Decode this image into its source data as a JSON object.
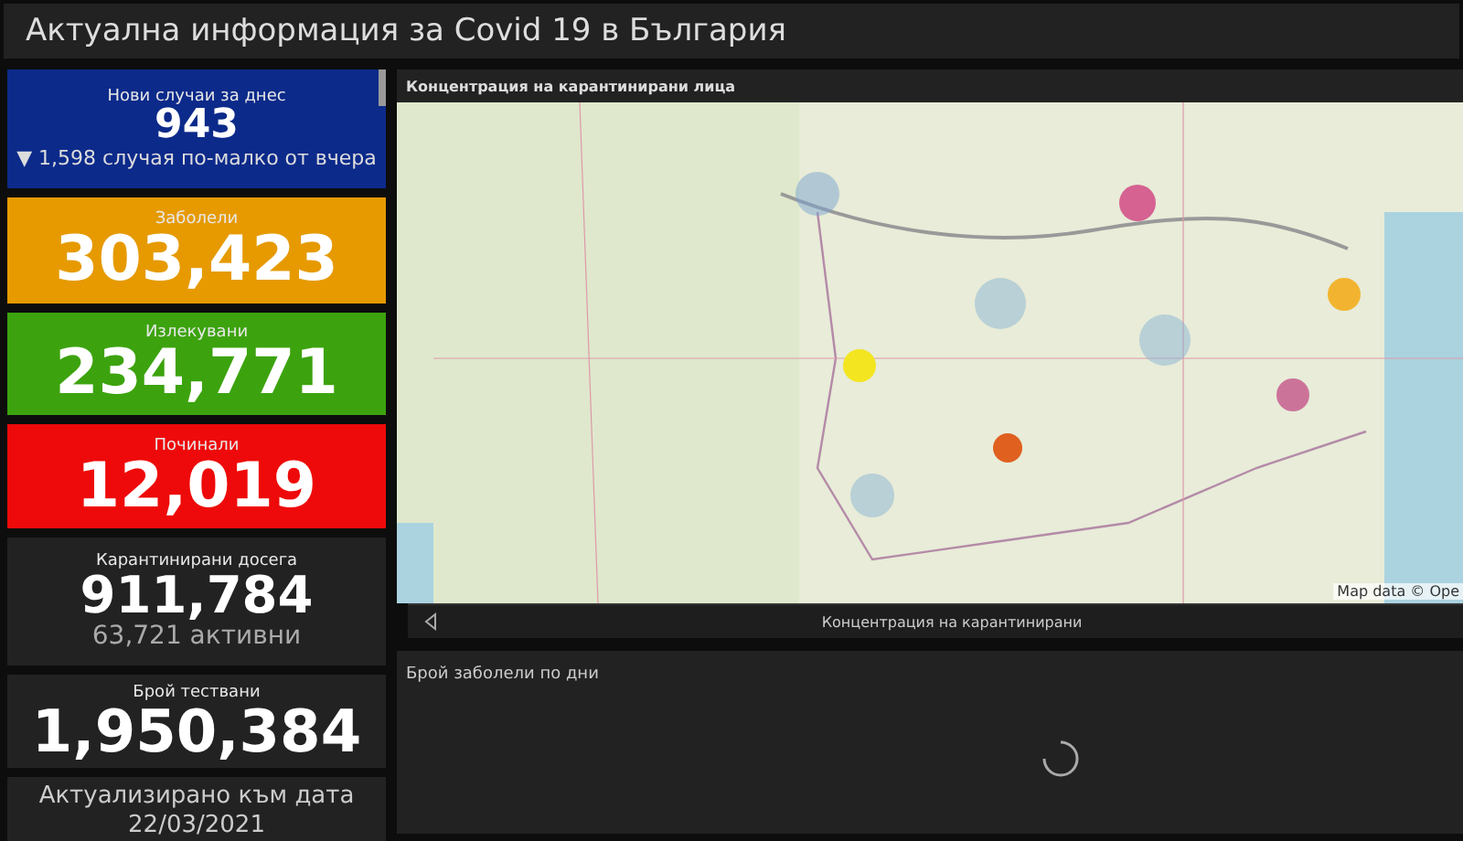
{
  "title": "Актуална информация за Covid 19 в България",
  "cards": [
    {
      "label": "Нови случаи за днес",
      "value": "943",
      "note": "▼ 1,598 случая по-малко от вчера",
      "color": "#0c2a8a"
    },
    {
      "label": "Заболели",
      "value": "303,423",
      "color": "#e69a00"
    },
    {
      "label": "Излекувани",
      "value": "234,771",
      "color": "#3ca30e"
    },
    {
      "label": "Починали",
      "value": "12,019",
      "color": "#ee0a0a"
    },
    {
      "label": "Карантинирани досега",
      "value": "911,784",
      "note": "63,721 активни",
      "color": "#222222"
    },
    {
      "label": "Брой тествани",
      "value": "1,950,384",
      "color": "#222222"
    }
  ],
  "updated": {
    "label": "Актуализирано към дата",
    "date": "22/03/2021"
  },
  "map_panel": {
    "title": "Концентрация на карантинирани лица",
    "attribution": "Map data © Ope",
    "caption": "Концентрация на карантинирани"
  },
  "chart_panel": {
    "title": "Брой заболели по дни"
  }
}
